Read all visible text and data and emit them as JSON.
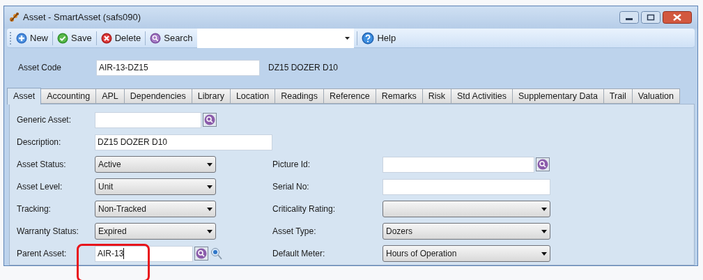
{
  "window": {
    "title": "Asset - SmartAsset (safs090)"
  },
  "toolbar": {
    "buttons": [
      {
        "label": "New",
        "kind": "new"
      },
      {
        "label": "Save",
        "kind": "save"
      },
      {
        "label": "Delete",
        "kind": "delete"
      },
      {
        "label": "Search",
        "kind": "search"
      }
    ],
    "help": {
      "label": "Help"
    }
  },
  "header": {
    "label": "Asset Code",
    "value": "AIR-13-DZ15",
    "description": "DZ15 DOZER D10"
  },
  "tabs": [
    {
      "label": "Asset",
      "selected": true
    },
    {
      "label": "Accounting",
      "selected": false
    },
    {
      "label": "APL",
      "selected": false
    },
    {
      "label": "Dependencies",
      "selected": false
    },
    {
      "label": "Library",
      "selected": false
    },
    {
      "label": "Location",
      "selected": false
    },
    {
      "label": "Readings",
      "selected": false
    },
    {
      "label": "Reference",
      "selected": false
    },
    {
      "label": "Remarks",
      "selected": false
    },
    {
      "label": "Risk",
      "selected": false
    },
    {
      "label": "Std Activities",
      "selected": false
    },
    {
      "label": "Supplementary Data",
      "selected": false
    },
    {
      "label": "Trail",
      "selected": false
    },
    {
      "label": "Valuation",
      "selected": false
    }
  ],
  "rows": [
    [
      {
        "label": "Generic Asset:",
        "kind": "lookup"
      }
    ],
    [
      {
        "label": "Description:",
        "kind": "wide",
        "value": "DZ15 DOZER D10"
      }
    ],
    [
      {
        "label": "Asset Status:",
        "kind": "select",
        "value": "Active"
      },
      {
        "label": "Picture Id:",
        "kind": "lookup"
      }
    ],
    [
      {
        "label": "Asset Level:",
        "kind": "select",
        "value": "Unit"
      },
      {
        "label": "Serial No:",
        "kind": "text"
      }
    ],
    [
      {
        "label": "Tracking:",
        "kind": "select",
        "value": "Non-Tracked"
      },
      {
        "label": "Criticality Rating:",
        "kind": "select"
      }
    ],
    [
      {
        "label": "Warranty Status:",
        "kind": "select",
        "value": "Expired"
      },
      {
        "label": "Asset Type:",
        "kind": "select",
        "value": "Dozers"
      }
    ],
    [
      {
        "label": "Parent Asset:",
        "kind": "lookup_add",
        "value": "AIR-13"
      },
      {
        "label": "Default Meter:",
        "kind": "select",
        "value": "Hours of Operation"
      }
    ]
  ]
}
